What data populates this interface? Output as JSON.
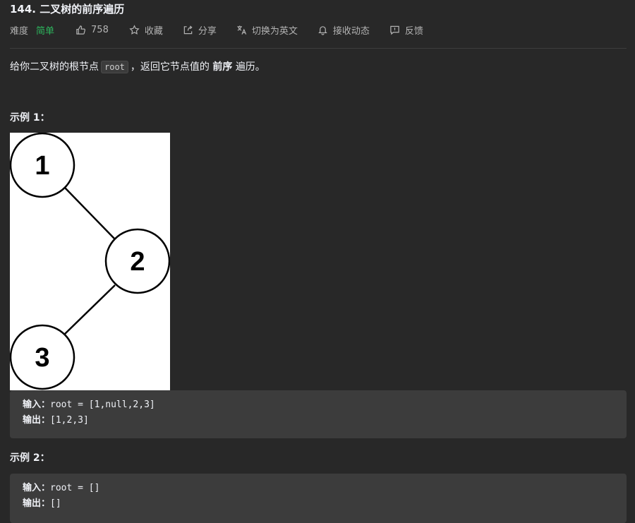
{
  "problem": {
    "title": "144. 二叉树的前序遍历",
    "difficulty_label": "难度",
    "difficulty": "简单",
    "likes": "758",
    "favorite_label": "收藏",
    "share_label": "分享",
    "switch_lang_label": "切换为英文",
    "subscribe_label": "接收动态",
    "feedback_label": "反馈"
  },
  "description": {
    "prefix": "给你二叉树的根节点",
    "code": "root",
    "middle": "，返回它节点值的",
    "bold": "前序",
    "suffix": "遍历。"
  },
  "example1": {
    "title": "示例 1：",
    "tree_nodes": [
      "1",
      "2",
      "3"
    ],
    "input_label": "输入：",
    "input_value": "root = [1,null,2,3]",
    "output_label": "输出：",
    "output_value": "[1,2,3]"
  },
  "example2": {
    "title": "示例 2：",
    "input_label": "输入：",
    "input_value": "root = []",
    "output_label": "输出：",
    "output_value": "[]"
  }
}
